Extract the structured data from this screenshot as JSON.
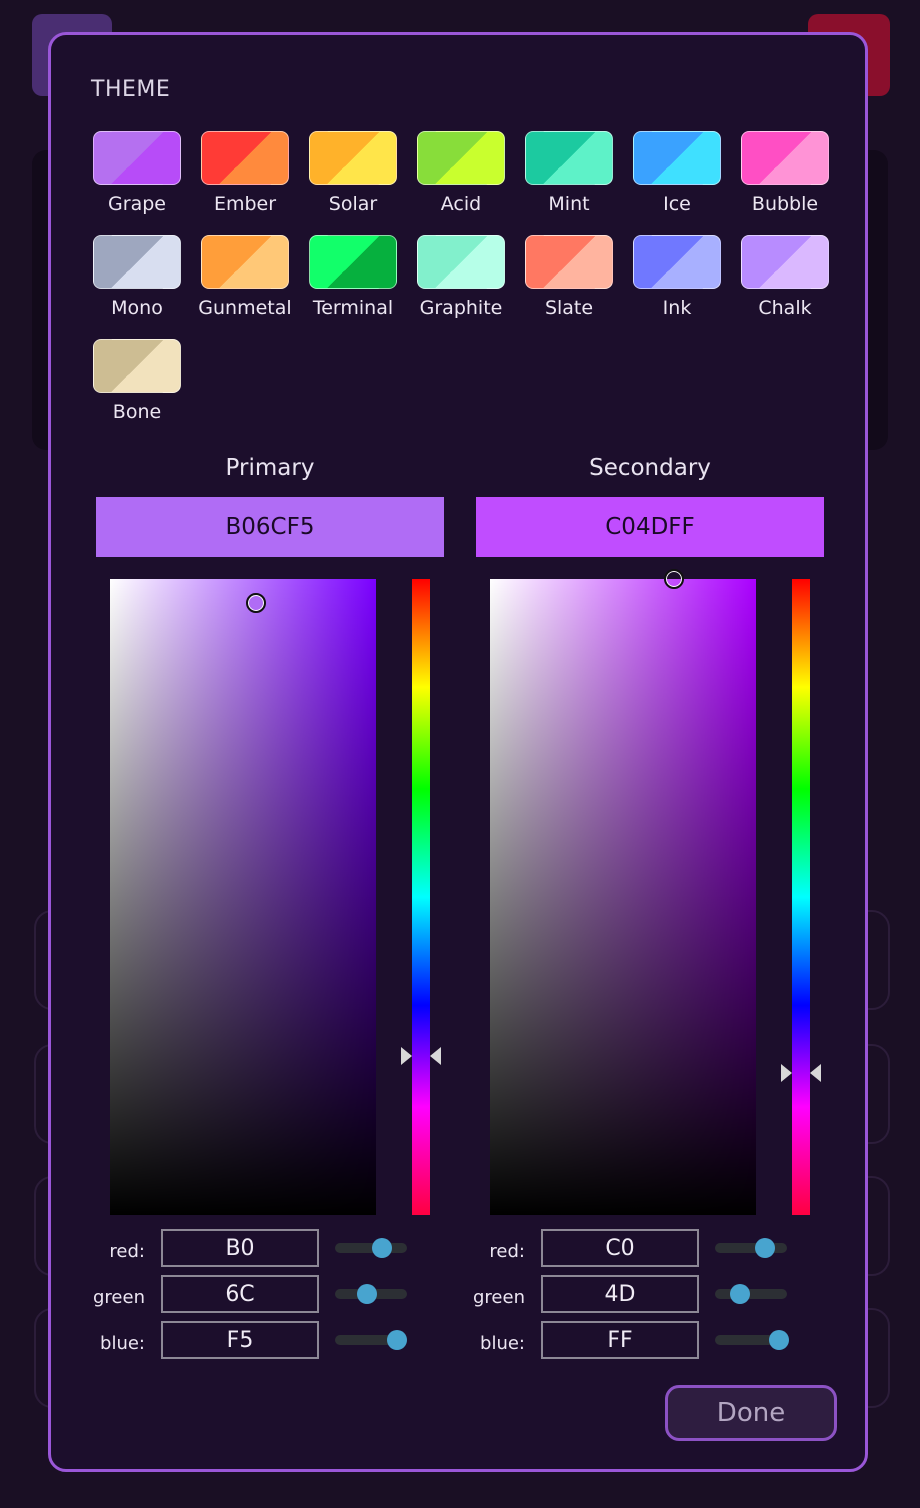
{
  "theme": {
    "title": "THEME",
    "swatches": [
      {
        "name": "Grape",
        "c1": "#b570f0",
        "c2": "#b74cf8"
      },
      {
        "name": "Ember",
        "c1": "#ff3b36",
        "c2": "#ff8a3d"
      },
      {
        "name": "Solar",
        "c1": "#ffb22a",
        "c2": "#ffe54a"
      },
      {
        "name": "Acid",
        "c1": "#88dd3a",
        "c2": "#c9ff2e"
      },
      {
        "name": "Mint",
        "c1": "#1ccaa0",
        "c2": "#5ef2c8"
      },
      {
        "name": "Ice",
        "c1": "#3aa2ff",
        "c2": "#3fe0ff"
      },
      {
        "name": "Bubble",
        "c1": "#ff4fc4",
        "c2": "#ff93d6"
      },
      {
        "name": "Mono",
        "c1": "#9ea7bf",
        "c2": "#d8def0"
      },
      {
        "name": "Gunmetal",
        "c1": "#ff9e3a",
        "c2": "#ffc877"
      },
      {
        "name": "Terminal",
        "c1": "#12ff6a",
        "c2": "#06b03e"
      },
      {
        "name": "Graphite",
        "c1": "#82f0cc",
        "c2": "#b6ffe8"
      },
      {
        "name": "Slate",
        "c1": "#ff7862",
        "c2": "#ffb49f"
      },
      {
        "name": "Ink",
        "c1": "#7078ff",
        "c2": "#a8b0ff"
      },
      {
        "name": "Chalk",
        "c1": "#b88cff",
        "c2": "#dab8ff"
      },
      {
        "name": "Bone",
        "c1": "#cdbd93",
        "c2": "#f2e2bd"
      }
    ]
  },
  "primary": {
    "title": "Primary",
    "hex": "B06CF5",
    "color": "#b06cf5",
    "hue_color": "#7a00ff",
    "red_label": "red:",
    "red": "B0",
    "red_level": 0.69,
    "green_label": "green",
    "green": "6C",
    "green_level": 0.42,
    "blue_label": "blue:",
    "blue": "F5",
    "blue_level": 0.96
  },
  "secondary": {
    "title": "Secondary",
    "hex": "C04DFF",
    "color": "#c04dff",
    "hue_color": "#aa00ff",
    "red_label": "red:",
    "red": "C0",
    "red_level": 0.75,
    "green_label": "green",
    "green": "4D",
    "green_level": 0.3,
    "blue_label": "blue:",
    "blue": "FF",
    "blue_level": 1.0
  },
  "done_label": "Done"
}
